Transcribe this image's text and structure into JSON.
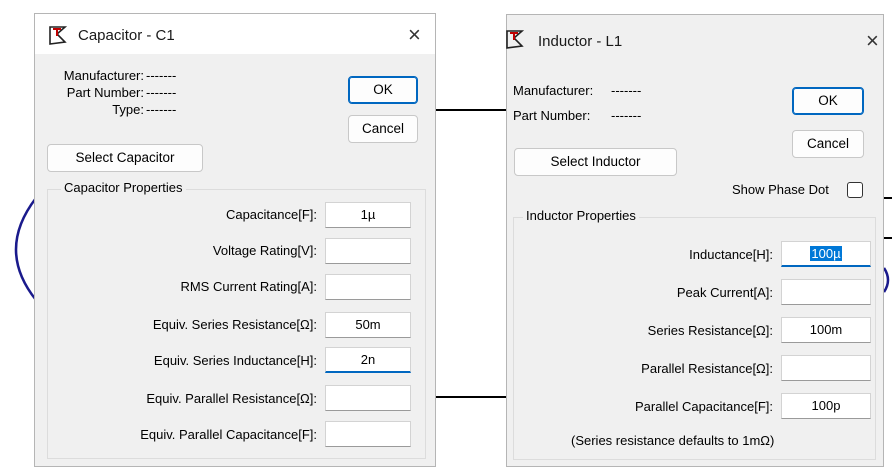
{
  "capacitor_dialog": {
    "title": "Capacitor - C1",
    "close_glyph": "×",
    "manufacturer_label": "Manufacturer:",
    "manufacturer_value": "-------",
    "part_number_label": "Part Number:",
    "part_number_value": "-------",
    "type_label": "Type:",
    "type_value": "-------",
    "ok_label": "OK",
    "cancel_label": "Cancel",
    "select_label": "Select Capacitor",
    "group_title": "Capacitor Properties",
    "props": [
      {
        "label": "Capacitance[F]:",
        "value": "1µ"
      },
      {
        "label": "Voltage Rating[V]:",
        "value": ""
      },
      {
        "label": "RMS Current Rating[A]:",
        "value": ""
      },
      {
        "label": "Equiv. Series Resistance[Ω]:",
        "value": "50m"
      },
      {
        "label": "Equiv. Series Inductance[H]:",
        "value": "2n"
      },
      {
        "label": "Equiv. Parallel Resistance[Ω]:",
        "value": ""
      },
      {
        "label": "Equiv. Parallel Capacitance[F]:",
        "value": ""
      }
    ]
  },
  "inductor_dialog": {
    "title": "Inductor - L1",
    "close_glyph": "×",
    "manufacturer_label": "Manufacturer:",
    "manufacturer_value": "-------",
    "part_number_label": "Part Number:",
    "part_number_value": "-------",
    "ok_label": "OK",
    "cancel_label": "Cancel",
    "select_label": "Select Inductor",
    "show_phase_dot_label": "Show Phase Dot",
    "show_phase_dot_checked": false,
    "group_title": "Inductor Properties",
    "props": [
      {
        "label": "Inductance[H]:",
        "value": "100µ"
      },
      {
        "label": "Peak Current[A]:",
        "value": ""
      },
      {
        "label": "Series Resistance[Ω]:",
        "value": "100m"
      },
      {
        "label": "Parallel Resistance[Ω]:",
        "value": ""
      },
      {
        "label": "Parallel Capacitance[F]:",
        "value": "100p"
      }
    ],
    "note": "(Series resistance defaults to 1mΩ)"
  },
  "colors": {
    "accent": "#0067c0",
    "selection": "#0078d7",
    "dialog_bg": "#f0f0f0",
    "wire": "#000000",
    "schematic_arc": "#1a1a8c"
  }
}
